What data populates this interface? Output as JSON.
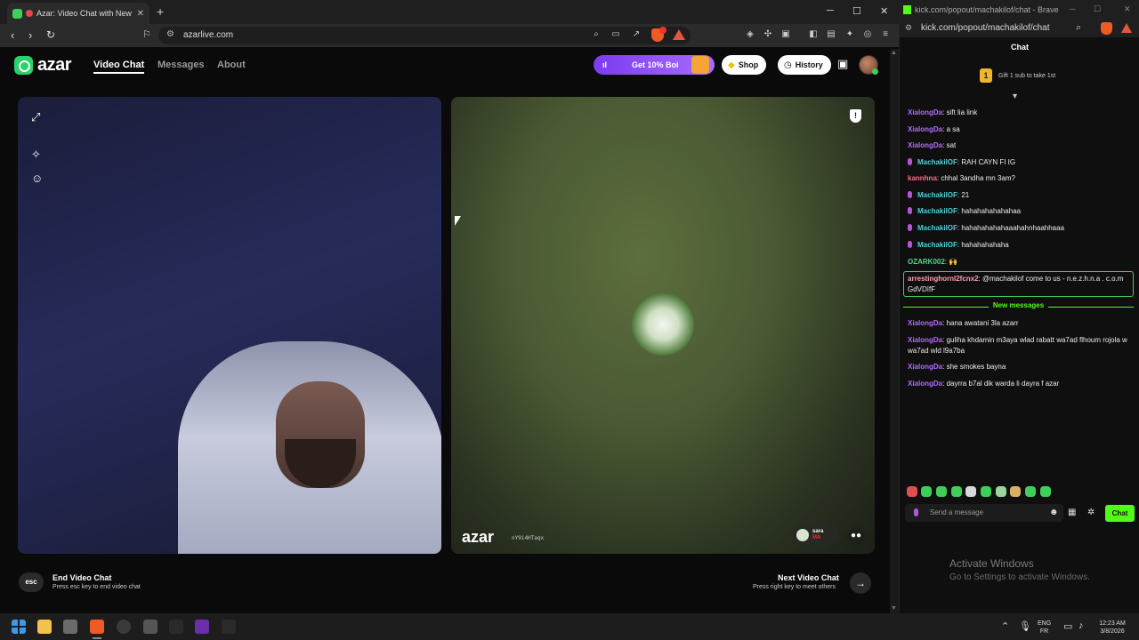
{
  "left_browser": {
    "tab_title": "Azar: Video Chat with New Pe",
    "url": "azarlive.com",
    "window_controls": [
      "─",
      "☐",
      "✕"
    ]
  },
  "azar": {
    "logo_text": "azar",
    "nav": [
      {
        "label": "Video Chat",
        "active": true
      },
      {
        "label": "Messages",
        "active": false
      },
      {
        "label": "About",
        "active": false
      }
    ],
    "promo_label": "Get 10% Boi",
    "shop_label": "Shop",
    "history_label": "History",
    "watermark": "azar",
    "watermark_id": "nY9i4HTaqx",
    "peer_tag": {
      "name": "sara",
      "country": "MA"
    },
    "end_chat": {
      "key": "esc",
      "title": "End Video Chat",
      "subtitle": "Press esc key to end video chat"
    },
    "next_chat": {
      "title": "Next Video Chat",
      "subtitle": "Press right key to meet others"
    }
  },
  "right_browser": {
    "window_title": "kick.com/popout/machakilof/chat - Brave",
    "url": "kick.com/popout/machakilof/chat",
    "chat_header": "Chat",
    "gift_banner": "Gift 1 sub to take 1st",
    "gift_count": "1",
    "messages": [
      {
        "user": "XialongDa",
        "color": "#b36bff",
        "text": ": sift lia link",
        "mic": false
      },
      {
        "user": "XialongDa",
        "color": "#b36bff",
        "text": ": a sa",
        "mic": false
      },
      {
        "user": "XialongDa",
        "color": "#b36bff",
        "text": ": sat",
        "mic": false
      },
      {
        "user": "MachakilOF",
        "color": "#4fd1d9",
        "text": ": RAH CAYN FI IG",
        "mic": true
      },
      {
        "user": "kannhna",
        "color": "#ff6b8a",
        "text": ": chhal 3andha mn 3am?",
        "mic": false
      },
      {
        "user": "MachakilOF",
        "color": "#4fd1d9",
        "text": ": 21",
        "mic": true
      },
      {
        "user": "MachakilOF",
        "color": "#4fd1d9",
        "text": ": hahahahahahahaa",
        "mic": true
      },
      {
        "user": "MachakilOF",
        "color": "#4fd1d9",
        "text": ": hahahahahahaaahahnhaahhaaa",
        "mic": true
      },
      {
        "user": "MachakilOF",
        "color": "#4fd1d9",
        "text": ": hahahahahaha",
        "mic": true
      },
      {
        "user": "OZARK002",
        "color": "#53d68a",
        "text": ": 🙌",
        "mic": false
      }
    ],
    "highlighted_message": {
      "user": "arrestinghornl2fcnx2",
      "color": "#ff9eb0",
      "text": ": @machakilof come to us - n.e.z.h.n.a . c.o.m GdVDIfF"
    },
    "new_messages_label": "New messages",
    "new_messages": [
      {
        "user": "XialongDa",
        "color": "#b36bff",
        "text": ": hana awatani 3la azarr"
      },
      {
        "user": "XialongDa",
        "color": "#b36bff",
        "text": ": guliha khdamin m3aya wlad rabatt wa7ad flhoum rojola w wa7ad wld l9a7ba"
      },
      {
        "user": "XialongDa",
        "color": "#b36bff",
        "text": ": she smokes bayna"
      },
      {
        "user": "XialongDa",
        "color": "#b36bff",
        "text": ": dayrra b7al dik warda li dayra f azar"
      }
    ],
    "input_placeholder": "Send a message",
    "chat_button": "Chat"
  },
  "watermark_windows": {
    "line1": "Activate Windows",
    "line2": "Go to Settings to activate Windows."
  },
  "taskbar": {
    "lang_top": "ENG",
    "lang_bottom": "FR",
    "time": "12:23 AM",
    "date": "3/8/2026"
  }
}
